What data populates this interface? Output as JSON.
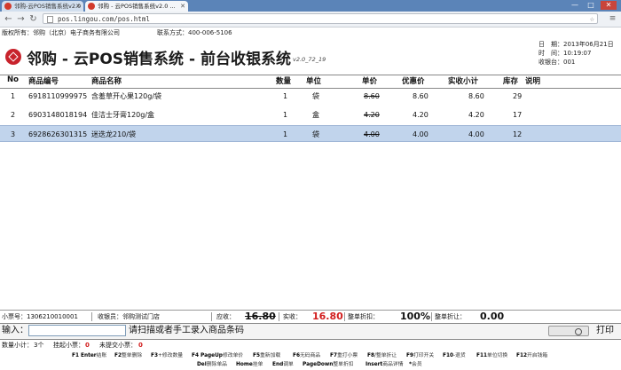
{
  "browser": {
    "tabs": [
      {
        "label": "邻购-云POS销售系统v2.0"
      },
      {
        "label": "邻购 - 云POS销售系统v2.0 ..."
      }
    ],
    "url": "pos.lingou.com/pos.html"
  },
  "info_line": {
    "copyright": "版权所有：邻购（北京）电子商务有限公司",
    "contact": "联系方式：400-006-5106"
  },
  "header": {
    "title": "邻购 - 云POS销售系统 - 前台收银系统",
    "version": "v2.0_72_19",
    "date": "日　期：2013年06月21日",
    "time": "时　间：10:19:07",
    "register": "收银台：001"
  },
  "table": {
    "columns": [
      "No",
      "商品编号",
      "商品名称",
      "数量",
      "单位",
      "单价",
      "优惠价",
      "实收小计",
      "库存",
      "说明"
    ],
    "rows": [
      {
        "no": "1",
        "code": "6918110999975",
        "name": "含羞草开心果120g/袋",
        "qty": "1",
        "unit": "袋",
        "price": "8.60",
        "promo": "8.60",
        "subtotal": "8.60",
        "stock": "29",
        "note": ""
      },
      {
        "no": "2",
        "code": "6903148018194",
        "name": "佳洁士牙膏120g/盒",
        "qty": "1",
        "unit": "盒",
        "price": "4.20",
        "promo": "4.20",
        "subtotal": "4.20",
        "stock": "17",
        "note": ""
      },
      {
        "no": "3",
        "code": "6928626301315",
        "name": "迷迭龙210/袋",
        "qty": "1",
        "unit": "袋",
        "price": "4.00",
        "promo": "4.00",
        "subtotal": "4.00",
        "stock": "12",
        "note": ""
      }
    ],
    "selected_row": 2
  },
  "status": {
    "receipt_no": "小票号：1306210010001",
    "store": "收银员：邻购测试门店",
    "due_label": "应收：",
    "due_value": "16.80",
    "paid_label": "实收：",
    "paid_value": "16.80",
    "discount_label": "整单折扣：",
    "discount_value": "100%",
    "reduce_label": "整单折让：",
    "reduce_value": "0.00"
  },
  "input": {
    "label": "输入：",
    "value": "",
    "hint": "请扫描或者手工录入商品条码",
    "print_label": "打印"
  },
  "summary": {
    "count_label": "数量小计：",
    "count_value": "3个",
    "hang_label": "挂起小票：",
    "hang_value": "0",
    "unsettled_label": "未提交小票：",
    "unsettled_value": "0"
  },
  "shortcuts": {
    "row1": [
      {
        "key": "F1 Enter",
        "desc": "结账"
      },
      {
        "key": "F2",
        "desc": "整单删除"
      },
      {
        "key": "F3",
        "desc": "+修改数量"
      },
      {
        "key": "F4 PageUp",
        "desc": "修改单价"
      },
      {
        "key": "F5",
        "desc": "重新加载"
      },
      {
        "key": "F6",
        "desc": "无码商品"
      },
      {
        "key": "F7",
        "desc": "重打小票"
      },
      {
        "key": "F8",
        "desc": "/整单折让"
      },
      {
        "key": "F9",
        "desc": "打印开关"
      },
      {
        "key": "F10",
        "desc": "-退货"
      },
      {
        "key": "F11",
        "desc": "单位切换"
      },
      {
        "key": "F12",
        "desc": "开启钱箱"
      }
    ],
    "row2": [
      {
        "key": "Del",
        "desc": "删除单品"
      },
      {
        "key": "Home",
        "desc": "挂单"
      },
      {
        "key": "End",
        "desc": "调单"
      },
      {
        "key": "PageDown",
        "desc": "整单折扣"
      },
      {
        "key": "Insert",
        "desc": "商品详情"
      },
      {
        "key": "*",
        "desc": "会员"
      }
    ]
  }
}
